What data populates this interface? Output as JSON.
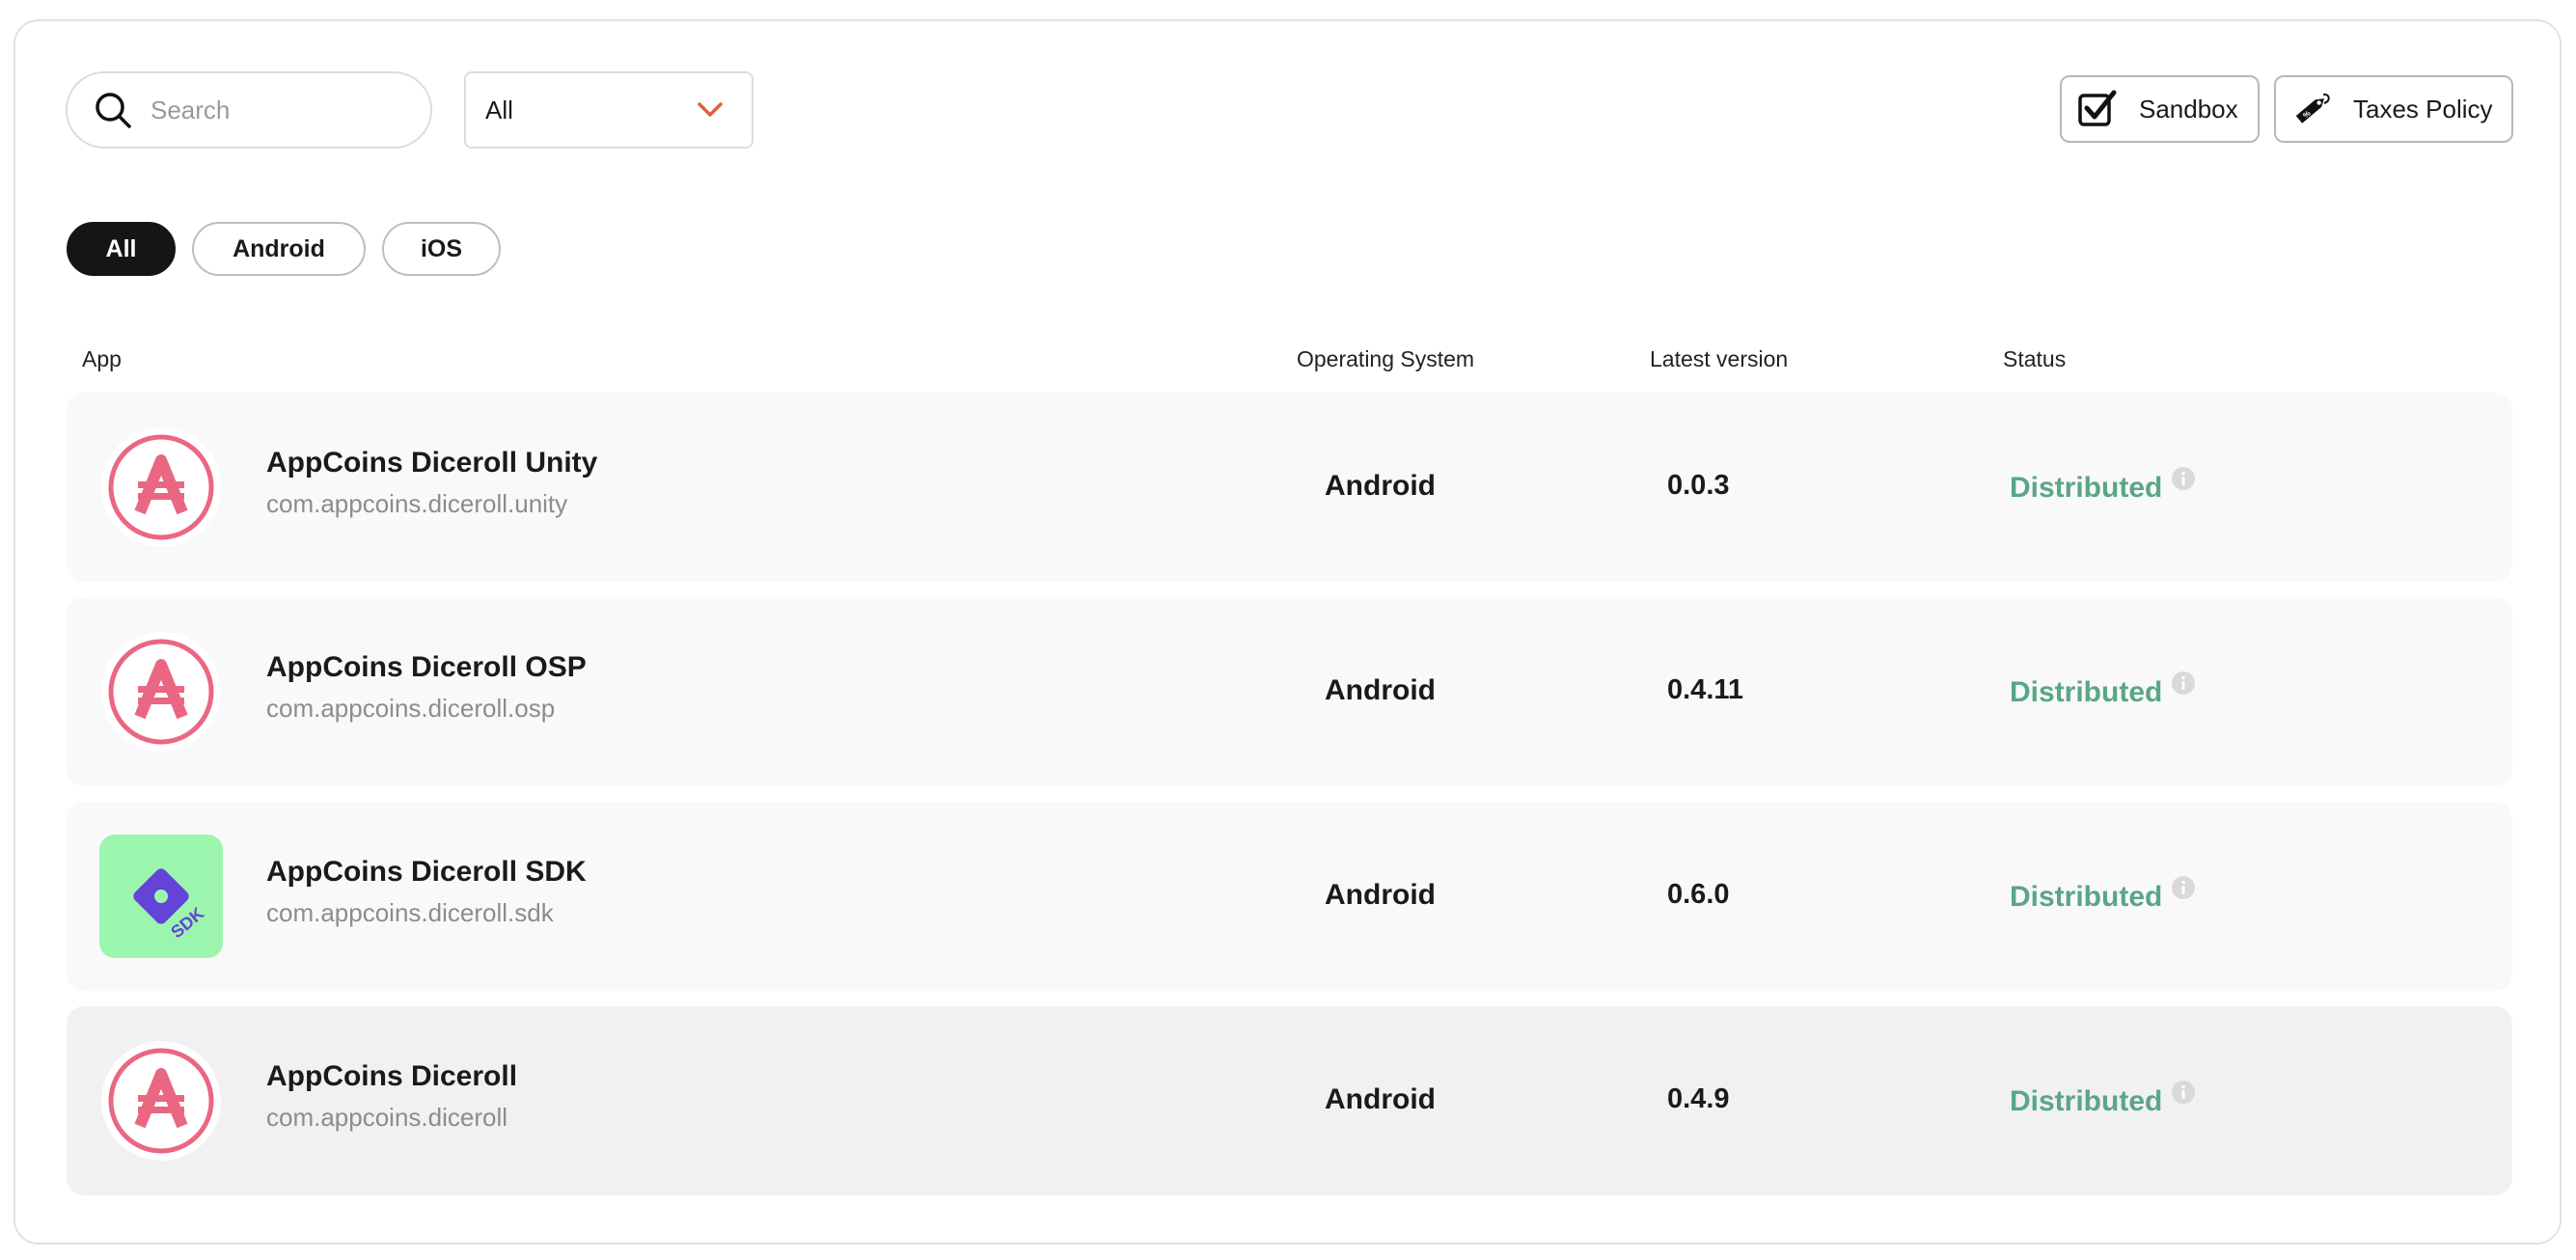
{
  "search": {
    "placeholder": "Search",
    "value": ""
  },
  "filter_select": {
    "selected": "All"
  },
  "buttons": {
    "sandbox": "Sandbox",
    "taxes": "Taxes Policy"
  },
  "os_filters": [
    {
      "label": "All",
      "active": true
    },
    {
      "label": "Android",
      "active": false
    },
    {
      "label": "iOS",
      "active": false
    }
  ],
  "table": {
    "headers": {
      "app": "App",
      "os": "Operating System",
      "version": "Latest version",
      "status": "Status"
    },
    "rows": [
      {
        "name": "AppCoins Diceroll Unity",
        "package": "com.appcoins.diceroll.unity",
        "os": "Android",
        "version": "0.0.3",
        "status": "Distributed",
        "icon": "appcoins-logo"
      },
      {
        "name": "AppCoins Diceroll OSP",
        "package": "com.appcoins.diceroll.osp",
        "os": "Android",
        "version": "0.4.11",
        "status": "Distributed",
        "icon": "appcoins-logo"
      },
      {
        "name": "AppCoins Diceroll SDK",
        "package": "com.appcoins.diceroll.sdk",
        "os": "Android",
        "version": "0.6.0",
        "status": "Distributed",
        "icon": "sdk-diamond-logo",
        "icon_text": "SDK"
      },
      {
        "name": "AppCoins Diceroll",
        "package": "com.appcoins.diceroll",
        "os": "Android",
        "version": "0.4.9",
        "status": "Distributed",
        "icon": "appcoins-logo"
      }
    ]
  },
  "colors": {
    "status_distributed": "#5aa687",
    "brand_pink": "#ea6782",
    "chevron": "#e0603f",
    "sdk_bg": "#9cf5ad",
    "sdk_diamond": "#6344d6"
  }
}
